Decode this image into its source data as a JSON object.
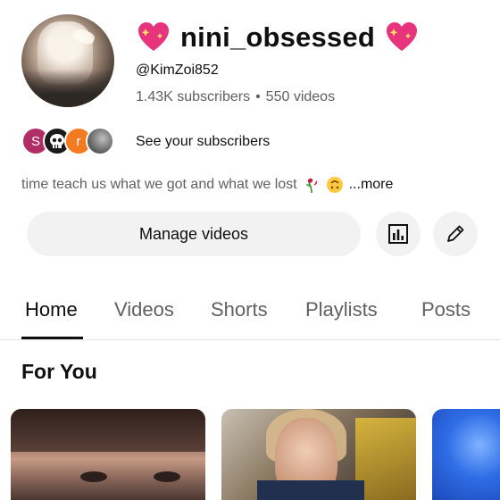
{
  "channel": {
    "name": "nini_obsessed",
    "handle": "@KimZoi852",
    "subscribers": "1.43K subscribers",
    "separator": "•",
    "videos": "550 videos",
    "title_emoji": "sparkling-heart"
  },
  "subscribers_preview": {
    "avatars": [
      {
        "kind": "letter",
        "letter": "S",
        "color": "#b02d66"
      },
      {
        "kind": "icon",
        "icon": "skull-icon",
        "color": "#1a1a1a"
      },
      {
        "kind": "letter",
        "letter": "r",
        "color": "#f47a20"
      },
      {
        "kind": "photo",
        "icon": "photo-avatar"
      }
    ],
    "label": "See your subscribers"
  },
  "description": {
    "text": "time teach us what we got and what we lost",
    "emojis": [
      "wilted-rose-icon",
      "upside-down-face-icon"
    ],
    "more": "...more"
  },
  "actions": {
    "manage_label": "Manage videos",
    "stats_icon": "analytics-icon",
    "edit_icon": "pencil-icon"
  },
  "tabs": [
    {
      "label": "Home",
      "active": true
    },
    {
      "label": "Videos",
      "active": false
    },
    {
      "label": "Shorts",
      "active": false
    },
    {
      "label": "Playlists",
      "active": false
    },
    {
      "label": "Posts",
      "active": false
    }
  ],
  "section": {
    "title": "For You"
  },
  "colors": {
    "text_primary": "#0f0f0f",
    "text_secondary": "#606060",
    "button_bg": "#f2f2f2",
    "heart_pink": "#e8337d"
  }
}
